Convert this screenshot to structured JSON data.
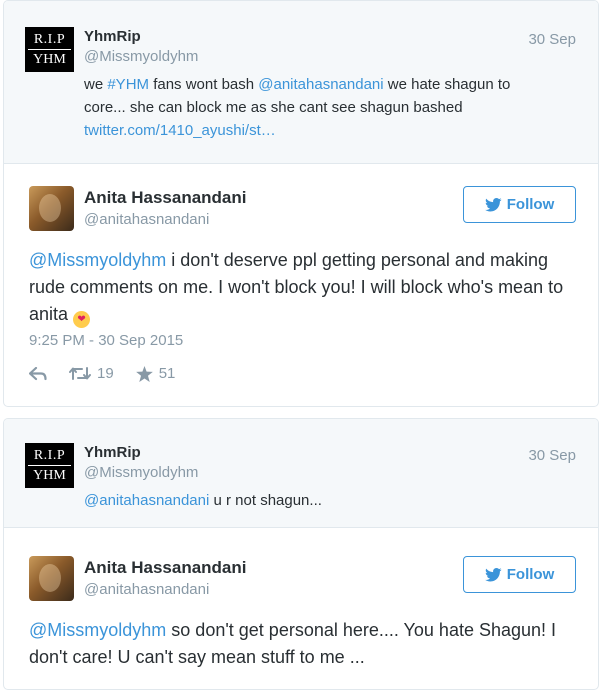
{
  "card1": {
    "parent": {
      "avatar_top": "R.I.P",
      "avatar_bottom": "YHM",
      "name": "YhmRip",
      "handle": "@Missmyoldyhm",
      "date": "30 Sep",
      "text_part1": "we ",
      "hashtag": "#YHM",
      "text_part2": " fans wont bash ",
      "mention": "@anitahasnandani",
      "text_part3": "  we hate shagun to core... she can block me as she cant see shagun bashed ",
      "link": "twitter.com/1410_ayushi/st…"
    },
    "reply": {
      "name": "Anita Hassanandani",
      "handle": "@anitahasnandani",
      "follow_label": "Follow",
      "mention": "@Missmyoldyhm",
      "text": " i don't deserve ppl getting personal and making rude comments on me. I won't block you! I will block who's mean to anita ",
      "emoji": "😘",
      "timestamp": "9:25 PM - 30 Sep 2015",
      "retweets": "19",
      "likes": "51"
    }
  },
  "card2": {
    "parent": {
      "avatar_top": "R.I.P",
      "avatar_bottom": "YHM",
      "name": "YhmRip",
      "handle": "@Missmyoldyhm",
      "date": "30 Sep",
      "mention": "@anitahasnandani",
      "text": " u r not shagun..."
    },
    "reply": {
      "name": "Anita Hassanandani",
      "handle": "@anitahasnandani",
      "follow_label": "Follow",
      "mention": "@Missmyoldyhm",
      "text": " so don't get personal here.... You hate Shagun! I don't care! U can't say mean stuff to me ..."
    }
  },
  "colors": {
    "link": "#3b94d9",
    "muted": "#8899a6",
    "text": "#292f33",
    "parent_bg": "#f5f8fa",
    "border": "#e1e8ed"
  },
  "icons": {
    "reply": "reply-icon",
    "retweet": "retweet-icon",
    "like": "star-icon",
    "follow": "twitter-bird-icon"
  }
}
